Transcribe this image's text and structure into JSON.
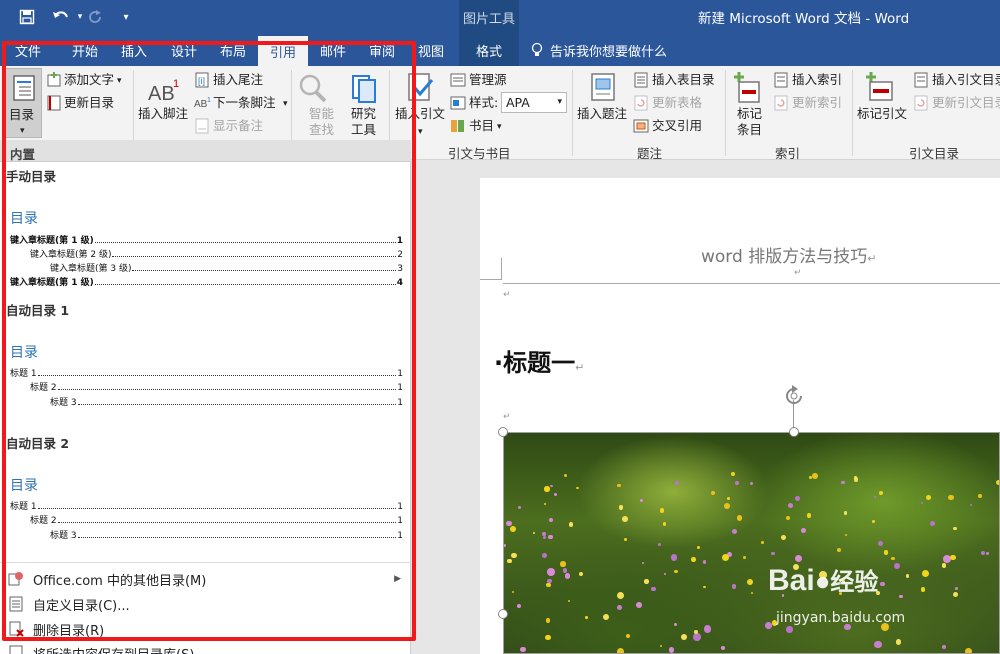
{
  "window": {
    "title": "新建 Microsoft Word 文档 - Word",
    "context_tool_label": "图片工具"
  },
  "qat": {
    "save_icon": "save-icon",
    "undo_icon": "undo-icon",
    "redo_icon": "redo-icon",
    "customize_icon": "customize-qat-icon"
  },
  "tabs": [
    "文件",
    "开始",
    "插入",
    "设计",
    "布局",
    "引用",
    "邮件",
    "审阅",
    "视图",
    "格式"
  ],
  "tell_me": "告诉我你想要做什么",
  "ribbon": {
    "toc_button": "目录",
    "add_text": "添加文字",
    "update_toc": "更新目录",
    "insert_footnote": "插入脚注",
    "insert_endnote": "插入尾注",
    "next_footnote": "下一条脚注",
    "show_notes": "显示备注",
    "smart_lookup_1": "智能",
    "smart_lookup_2": "查找",
    "researcher_1": "研究",
    "researcher_2": "工具",
    "insert_citation": "插入引文",
    "manage_sources": "管理源",
    "style_label": "样式:",
    "style_value": "APA",
    "bibliography": "书目",
    "group_citations": "引文与书目",
    "insert_caption": "插入题注",
    "insert_table_of_figures": "插入表目录",
    "update_table": "更新表格",
    "cross_reference": "交叉引用",
    "group_captions": "题注",
    "mark_entry_1": "标记",
    "mark_entry_2": "条目",
    "insert_index": "插入索引",
    "update_index": "更新索引",
    "group_index": "索引",
    "mark_citation": "标记引文",
    "insert_toa": "插入引文目录",
    "update_toa": "更新引文目录",
    "group_toa": "引文目录"
  },
  "toc_gallery": {
    "header": "内置",
    "manual": {
      "title": "手动目录",
      "heading": "目录",
      "rows": [
        {
          "label": "键入章标题(第 1 级)",
          "page": "1"
        },
        {
          "label": "键入章标题(第 2 级)",
          "page": "2"
        },
        {
          "label": "键入章标题(第 3 级)",
          "page": "3"
        },
        {
          "label": "键入章标题(第 1 级)",
          "page": "4"
        }
      ]
    },
    "auto1": {
      "title": "自动目录 1",
      "heading": "目录",
      "rows": [
        {
          "label": "标题 1",
          "page": "1"
        },
        {
          "label": "标题 2",
          "page": "1"
        },
        {
          "label": "标题 3",
          "page": "1"
        }
      ]
    },
    "auto2": {
      "title": "自动目录 2",
      "heading": "目录",
      "rows": [
        {
          "label": "标题 1",
          "page": "1"
        },
        {
          "label": "标题 2",
          "page": "1"
        },
        {
          "label": "标题 3",
          "page": "1"
        }
      ]
    },
    "menu": [
      {
        "label": "Office.com 中的其他目录(M)",
        "icon": "office-icon"
      },
      {
        "label": "自定义目录(C)...",
        "icon": "custom-toc-icon"
      },
      {
        "label": "删除目录(R)",
        "icon": "remove-toc-icon"
      },
      {
        "label": "将所选内容保存到目录库(S)...",
        "icon": "save-selection-icon"
      }
    ]
  },
  "document": {
    "header_text": "word 排版方法与技巧",
    "heading": "标题一",
    "paragraph_mark": "↵"
  },
  "watermark": {
    "brand": "Bai",
    "brand_suffix": "经验",
    "url": "jingyan.baidu.com"
  },
  "colors": {
    "titlebar": "#2b579a",
    "highlight_box": "#f01a1a",
    "toc_heading": "#2e74b5"
  }
}
